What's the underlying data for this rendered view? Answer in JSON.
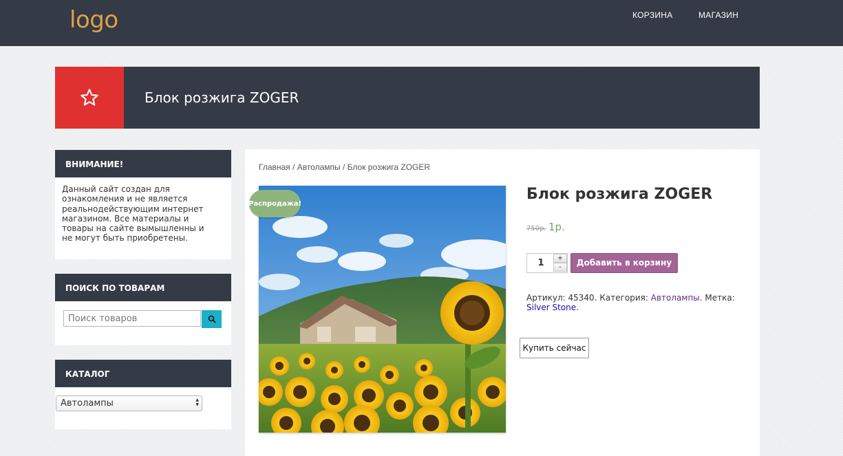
{
  "header": {
    "logo": "logo",
    "nav": [
      "КОРЗИНА",
      "МАГАЗИН"
    ]
  },
  "banner": {
    "title": "Блок розжига ZOGER",
    "icon": "star-icon"
  },
  "sidebar": {
    "attention": {
      "title": "ВНИМАНИЕ!",
      "text": "Данный сайт создан для ознакомления и не является реальнодействующим интернет магазином. Все материалы и товары на сайте вымышленны и не могут быть приобретены."
    },
    "search": {
      "title": "ПОИСК ПО ТОВАРАМ",
      "placeholder": "Поиск товаров",
      "button_icon": "search-icon"
    },
    "catalog": {
      "title": "КАТАЛОГ",
      "selected": "Автолампы"
    }
  },
  "breadcrumb": {
    "items": [
      "Главная",
      "Автолампы",
      "Блок розжига ZOGER"
    ],
    "separator": " / "
  },
  "product": {
    "sale_badge": "Распродажа!",
    "title": "Блок розжига ZOGER",
    "price_old": "750р.",
    "price_new": "1р.",
    "quantity": "1",
    "qty_plus": "+",
    "qty_minus": "-",
    "add_to_cart": "Добавить в корзину",
    "meta": {
      "sku_label": "Артикул:",
      "sku": "45340.",
      "category_label": "Категория:",
      "category": "Автолампы",
      "tag_label": "Метка:",
      "tag": "Silver Stone",
      "period": "."
    },
    "buy_now": "Купить сейчас",
    "image_subject": "sunflower-field-with-house"
  },
  "colors": {
    "header_bg": "#343a46",
    "logo": "#e0a046",
    "accent_red": "#e03131",
    "search_button": "#1cb0c8",
    "add_to_cart": "#a46497",
    "sale_badge": "#8fb57e",
    "price_new": "#77a464"
  }
}
